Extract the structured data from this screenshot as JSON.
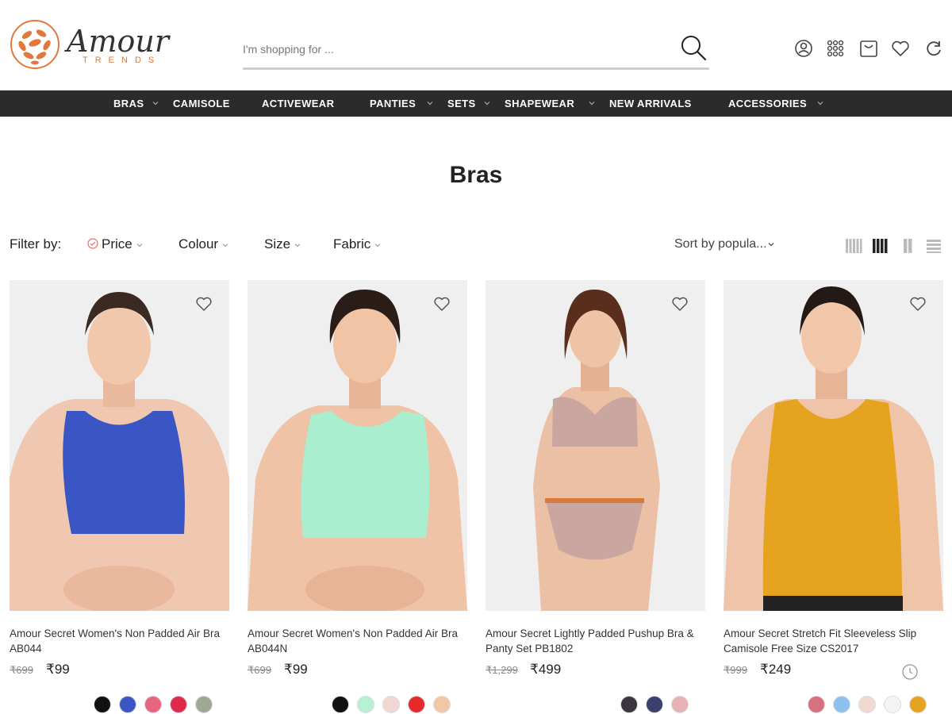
{
  "header": {
    "logo_text": "Amour",
    "logo_sub": "TRENDS",
    "search": {
      "placeholder": "I'm shopping for ..."
    },
    "icons": [
      "account-icon",
      "apps-grid-icon",
      "cart-icon",
      "wishlist-heart-icon",
      "refresh-icon"
    ]
  },
  "nav": {
    "items": [
      {
        "label": "BRAS",
        "has_dropdown": true
      },
      {
        "label": "CAMISOLE",
        "has_dropdown": false
      },
      {
        "label": "ACTIVEWEAR",
        "has_dropdown": false
      },
      {
        "label": "PANTIES",
        "has_dropdown": true
      },
      {
        "label": "SETS",
        "has_dropdown": true
      },
      {
        "label": "SHAPEWEAR",
        "has_dropdown": true
      },
      {
        "label": "NEW ARRIVALS",
        "has_dropdown": false
      },
      {
        "label": "ACCESSORIES",
        "has_dropdown": true
      }
    ]
  },
  "page": {
    "title": "Bras"
  },
  "filters": {
    "label": "Filter by:",
    "items": [
      "Price",
      "Colour",
      "Size",
      "Fabric"
    ],
    "sort_label": "Sort by popula..."
  },
  "products": [
    {
      "name": "Amour Secret Women's Non Padded Air Bra AB044",
      "price_old": "₹699",
      "price_new": "₹99",
      "garment_color": "#3a55c4",
      "swatches": [
        "#111111",
        "#3a55c4",
        "#e8647f",
        "#e0284a",
        "#9fa894"
      ]
    },
    {
      "name": "Amour Secret Women's Non Padded Air Bra AB044N",
      "price_old": "₹699",
      "price_new": "₹99",
      "garment_color": "#a9efcf",
      "swatches": [
        "#111111",
        "#b8f0d4",
        "#f1d6d2",
        "#e42a2a",
        "#f2c7a3"
      ]
    },
    {
      "name": "Amour Secret Lightly Padded Pushup Bra & Panty Set PB1802",
      "price_old": "₹1,299",
      "price_new": "₹499",
      "garment_color": "#c9a6a0",
      "swatches": [
        "#3b3640",
        "#3a3f6e",
        "#e6b2b3"
      ]
    },
    {
      "name": "Amour Secret Stretch Fit Sleeveless Slip Camisole Free Size CS2017",
      "price_old": "₹999",
      "price_new": "₹249",
      "garment_color": "#e6a31f",
      "swatches": [
        "#d9707f",
        "#8fc1ee",
        "#f1d9d2",
        "#f4f4f4",
        "#e6a31f"
      ]
    }
  ],
  "colors": {
    "navbar_bg": "#2b2b2b",
    "brand_orange": "#e07a3c",
    "image_bg": "#efefef"
  }
}
